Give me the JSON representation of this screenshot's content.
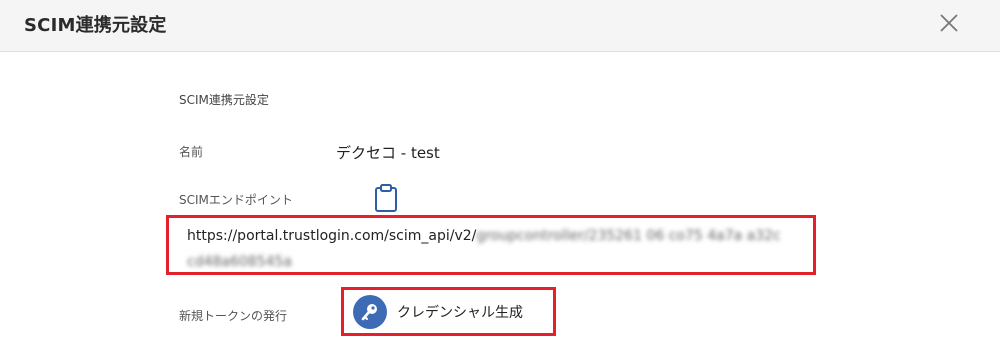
{
  "dialog": {
    "title": "SCIM連携元設定",
    "close_icon": "close-icon"
  },
  "section": {
    "title": "SCIM連携元設定"
  },
  "fields": {
    "name_label": "名前",
    "name_value": "デクセコ - test",
    "endpoint_label": "SCIMエンドポイント",
    "endpoint_url_visible": "https://portal.trustlogin.com/scim_api/v2/",
    "endpoint_url_redacted_line1": "groupcontroller/235261 06 co75 4a7a a32c",
    "endpoint_url_redacted_line2": "cd48a608545a",
    "clipboard_icon": "clipboard-icon",
    "token_label": "新規トークンの発行",
    "credential_button_label": "クレデンシャル生成",
    "key_icon": "key-icon"
  },
  "colors": {
    "header_bg": "#f5f5f5",
    "highlight_border": "#e3202b",
    "key_button_bg": "#3d6bb5",
    "clipboard_stroke": "#2f5ea8"
  }
}
